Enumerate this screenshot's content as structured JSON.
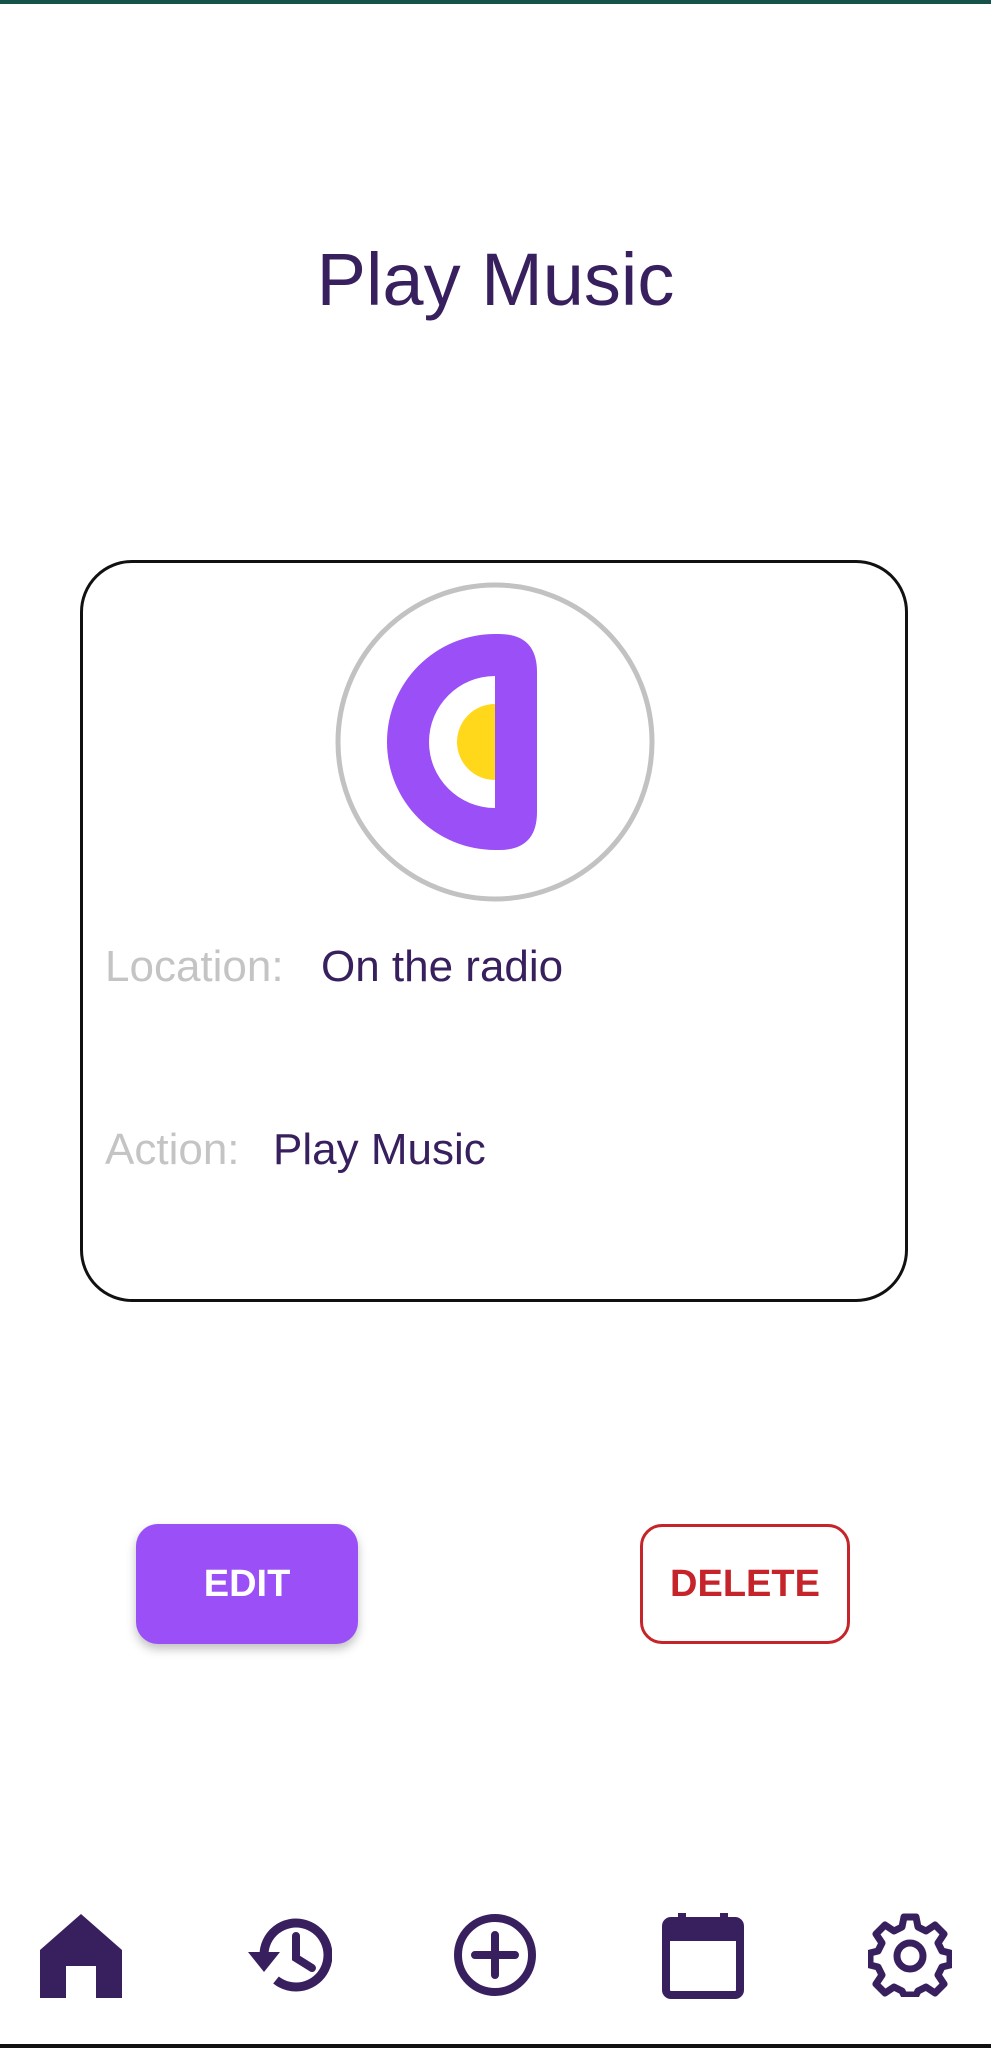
{
  "header": {
    "title": "Play Music"
  },
  "card": {
    "location_label": "Location:",
    "location_value": "On the radio",
    "action_label": "Action:",
    "action_value": "Play Music",
    "logo_icon": "half-circle-logo-icon"
  },
  "buttons": {
    "edit_label": "EDIT",
    "delete_label": "DELETE"
  },
  "nav": {
    "items": [
      {
        "icon": "home-icon"
      },
      {
        "icon": "history-icon"
      },
      {
        "icon": "add-circle-icon"
      },
      {
        "icon": "calendar-icon"
      },
      {
        "icon": "settings-gear-icon"
      }
    ]
  },
  "colors": {
    "primary_dark": "#38205e",
    "accent_purple": "#9a4ff7",
    "accent_yellow": "#ffd81c",
    "danger_red": "#c4242a",
    "label_gray": "#c4c4c4"
  }
}
